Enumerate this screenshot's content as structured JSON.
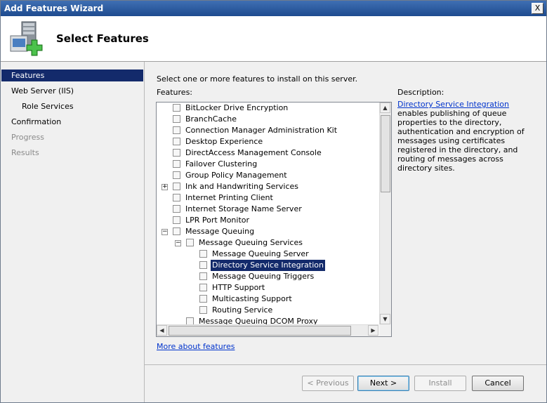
{
  "window": {
    "title": "Add Features Wizard",
    "close_glyph": "X"
  },
  "header": {
    "title": "Select Features"
  },
  "nav": {
    "items": [
      {
        "label": "Features",
        "state": "active"
      },
      {
        "label": "Web Server (IIS)",
        "state": "normal"
      },
      {
        "label": "Role Services",
        "state": "sub"
      },
      {
        "label": "Confirmation",
        "state": "normal"
      },
      {
        "label": "Progress",
        "state": "disabled"
      },
      {
        "label": "Results",
        "state": "disabled"
      }
    ]
  },
  "content": {
    "intro": "Select one or more features to install on this server.",
    "features_label": "Features:",
    "description_label": "Description:",
    "description_link": "Directory Service Integration",
    "description_text": "enables publishing of queue properties to the directory, authentication and encryption of messages using certificates registered in the directory, and routing of messages across directory sites.",
    "more_link": "More about features"
  },
  "features": [
    {
      "label": "BitLocker Drive Encryption",
      "level": 0,
      "expander": ""
    },
    {
      "label": "BranchCache",
      "level": 0,
      "expander": ""
    },
    {
      "label": "Connection Manager Administration Kit",
      "level": 0,
      "expander": ""
    },
    {
      "label": "Desktop Experience",
      "level": 0,
      "expander": ""
    },
    {
      "label": "DirectAccess Management Console",
      "level": 0,
      "expander": ""
    },
    {
      "label": "Failover Clustering",
      "level": 0,
      "expander": ""
    },
    {
      "label": "Group Policy Management",
      "level": 0,
      "expander": ""
    },
    {
      "label": "Ink and Handwriting Services",
      "level": 0,
      "expander": "+"
    },
    {
      "label": "Internet Printing Client",
      "level": 0,
      "expander": ""
    },
    {
      "label": "Internet Storage Name Server",
      "level": 0,
      "expander": ""
    },
    {
      "label": "LPR Port Monitor",
      "level": 0,
      "expander": ""
    },
    {
      "label": "Message Queuing",
      "level": 0,
      "expander": "−"
    },
    {
      "label": "Message Queuing Services",
      "level": 1,
      "expander": "−"
    },
    {
      "label": "Message Queuing Server",
      "level": 2,
      "expander": ""
    },
    {
      "label": "Directory Service Integration",
      "level": 2,
      "expander": "",
      "selected": true
    },
    {
      "label": "Message Queuing Triggers",
      "level": 2,
      "expander": ""
    },
    {
      "label": "HTTP Support",
      "level": 2,
      "expander": ""
    },
    {
      "label": "Multicasting Support",
      "level": 2,
      "expander": ""
    },
    {
      "label": "Routing Service",
      "level": 2,
      "expander": ""
    },
    {
      "label": "Message Queuing DCOM Proxy",
      "level": 1,
      "expander": ""
    }
  ],
  "scroll": {
    "up": "▲",
    "down": "▼",
    "left": "◀",
    "right": "▶"
  },
  "buttons": {
    "previous": "< Previous",
    "next": "Next >",
    "install": "Install",
    "cancel": "Cancel"
  }
}
